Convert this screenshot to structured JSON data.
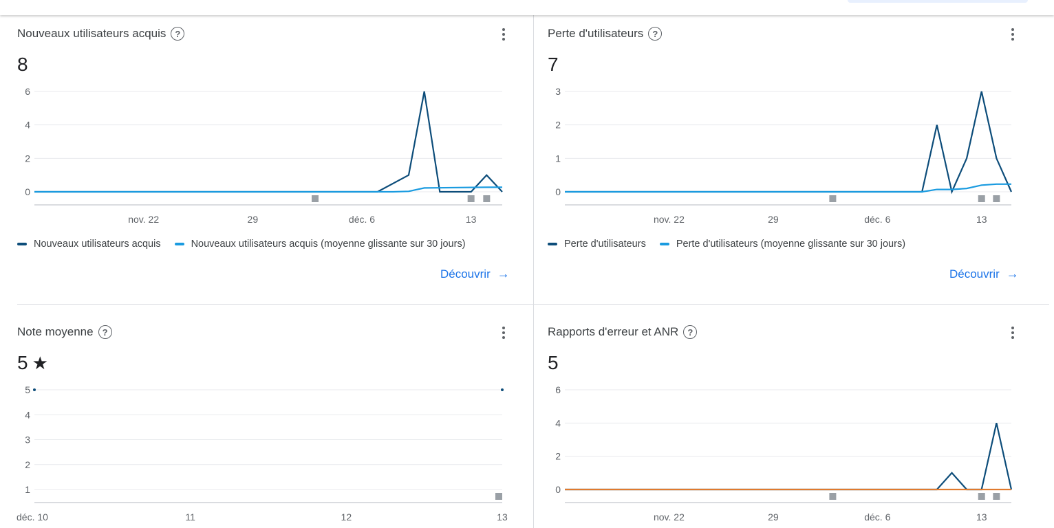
{
  "colors": {
    "primary_series": "#0d4d7a",
    "average_series": "#1a9be0",
    "error_series": "#e07a2e",
    "grid": "#e8eaed",
    "axis": "#dadce0",
    "marker": "#9aa0a6",
    "link": "#1a73e8"
  },
  "cards": [
    {
      "title": "Nouveaux utilisateurs acquis",
      "value": "8",
      "legend": [
        "Nouveaux utilisateurs acquis",
        "Nouveaux utilisateurs acquis (moyenne glissante sur 30 jours)"
      ],
      "link": "Découvrir"
    },
    {
      "title": "Perte d'utilisateurs",
      "value": "7",
      "legend": [
        "Perte d'utilisateurs",
        "Perte d'utilisateurs (moyenne glissante sur 30 jours)"
      ],
      "link": "Découvrir"
    },
    {
      "title": "Note moyenne",
      "value": "5",
      "value_icon": "star-icon"
    },
    {
      "title": "Rapports d'erreur et ANR",
      "value": "5"
    }
  ],
  "chart_data": [
    {
      "type": "line",
      "x_start": "2021-11-15",
      "x_end": "2021-12-15",
      "xticks": [
        {
          "date": "2021-11-22",
          "label": "nov. 22"
        },
        {
          "date": "2021-11-29",
          "label": "29"
        },
        {
          "date": "2021-12-06",
          "label": "déc. 6"
        },
        {
          "date": "2021-12-13",
          "label": "13"
        }
      ],
      "yticks": [
        0,
        2,
        4,
        6
      ],
      "ylim": [
        0,
        6
      ],
      "grid": true,
      "release_markers": [
        "2021-12-03",
        "2021-12-13",
        "2021-12-14"
      ],
      "series": [
        {
          "name": "Nouveaux utilisateurs acquis",
          "color": "#0d4d7a",
          "points": [
            [
              "2021-11-15",
              0
            ],
            [
              "2021-12-07",
              0
            ],
            [
              "2021-12-09",
              1
            ],
            [
              "2021-12-10",
              6
            ],
            [
              "2021-12-11",
              0
            ],
            [
              "2021-12-13",
              0
            ],
            [
              "2021-12-14",
              1
            ],
            [
              "2021-12-15",
              0
            ]
          ]
        },
        {
          "name": "Nouveaux utilisateurs acquis (moyenne glissante sur 30 jours)",
          "color": "#1a9be0",
          "points": [
            [
              "2021-11-15",
              0
            ],
            [
              "2021-12-08",
              0
            ],
            [
              "2021-12-09",
              0.03
            ],
            [
              "2021-12-10",
              0.23
            ],
            [
              "2021-12-14",
              0.27
            ],
            [
              "2021-12-15",
              0.27
            ]
          ]
        }
      ]
    },
    {
      "type": "line",
      "x_start": "2021-11-15",
      "x_end": "2021-12-15",
      "xticks": [
        {
          "date": "2021-11-22",
          "label": "nov. 22"
        },
        {
          "date": "2021-11-29",
          "label": "29"
        },
        {
          "date": "2021-12-06",
          "label": "déc. 6"
        },
        {
          "date": "2021-12-13",
          "label": "13"
        }
      ],
      "yticks": [
        0,
        1,
        2,
        3
      ],
      "ylim": [
        0,
        3
      ],
      "grid": true,
      "release_markers": [
        "2021-12-03",
        "2021-12-13",
        "2021-12-14"
      ],
      "series": [
        {
          "name": "Perte d'utilisateurs",
          "color": "#0d4d7a",
          "points": [
            [
              "2021-11-15",
              0
            ],
            [
              "2021-12-09",
              0
            ],
            [
              "2021-12-10",
              2
            ],
            [
              "2021-12-11",
              0
            ],
            [
              "2021-12-12",
              1
            ],
            [
              "2021-12-13",
              3
            ],
            [
              "2021-12-14",
              1
            ],
            [
              "2021-12-15",
              0
            ]
          ]
        },
        {
          "name": "Perte d'utilisateurs (moyenne glissante sur 30 jours)",
          "color": "#1a9be0",
          "points": [
            [
              "2021-11-15",
              0
            ],
            [
              "2021-12-09",
              0
            ],
            [
              "2021-12-10",
              0.07
            ],
            [
              "2021-12-11",
              0.07
            ],
            [
              "2021-12-12",
              0.1
            ],
            [
              "2021-12-13",
              0.2
            ],
            [
              "2021-12-14",
              0.23
            ],
            [
              "2021-12-15",
              0.23
            ]
          ]
        }
      ]
    },
    {
      "type": "line",
      "x_start": "2021-12-10",
      "x_end": "2021-12-13",
      "xticks": [
        {
          "date": "2021-12-10",
          "label": "déc. 10"
        },
        {
          "date": "2021-12-11",
          "label": "11"
        },
        {
          "date": "2021-12-12",
          "label": "12"
        },
        {
          "date": "2021-12-13",
          "label": "13"
        }
      ],
      "yticks": [
        1,
        2,
        3,
        4,
        5
      ],
      "ylim": [
        1,
        5
      ],
      "grid": true,
      "release_markers": [
        "2021-12-13"
      ],
      "series": [
        {
          "color": "#0d4d7a",
          "points_only": true,
          "points": [
            [
              "2021-12-10",
              5
            ],
            [
              "2021-12-13",
              5
            ]
          ]
        }
      ]
    },
    {
      "type": "line",
      "x_start": "2021-11-15",
      "x_end": "2021-12-15",
      "xticks": [
        {
          "date": "2021-11-22",
          "label": "nov. 22"
        },
        {
          "date": "2021-11-29",
          "label": "29"
        },
        {
          "date": "2021-12-06",
          "label": "déc. 6"
        },
        {
          "date": "2021-12-13",
          "label": "13"
        }
      ],
      "yticks": [
        0,
        2,
        4,
        6
      ],
      "ylim": [
        0,
        6
      ],
      "grid": true,
      "release_markers": [
        "2021-12-03",
        "2021-12-13",
        "2021-12-14"
      ],
      "series": [
        {
          "color": "#0d4d7a",
          "points": [
            [
              "2021-11-15",
              0
            ],
            [
              "2021-12-10",
              0
            ],
            [
              "2021-12-11",
              1
            ],
            [
              "2021-12-12",
              0
            ],
            [
              "2021-12-13",
              0
            ],
            [
              "2021-12-14",
              4
            ],
            [
              "2021-12-15",
              0
            ]
          ]
        },
        {
          "color": "#e07a2e",
          "points": [
            [
              "2021-11-15",
              0
            ],
            [
              "2021-12-15",
              0
            ]
          ]
        }
      ]
    }
  ]
}
